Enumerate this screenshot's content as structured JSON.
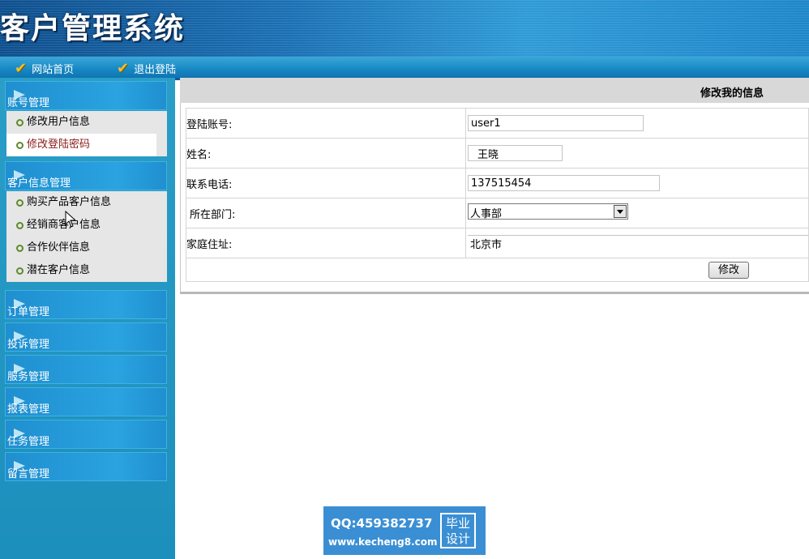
{
  "header": {
    "title": "客户管理系统"
  },
  "topnav": [
    {
      "label": "网站首页"
    },
    {
      "label": "退出登陆"
    }
  ],
  "sidebar": {
    "groups": [
      {
        "label": "账号管理",
        "items": [
          "修改用户信息",
          "修改登陆密码"
        ],
        "active_item": "修改登陆密码"
      },
      {
        "label": "客户信息管理",
        "items": [
          "购买产品客户信息",
          "经销商客户信息",
          "合作伙伴信息",
          "潜在客户信息"
        ]
      },
      {
        "label": "订单管理",
        "items": []
      },
      {
        "label": "投诉管理",
        "items": []
      },
      {
        "label": "服务管理",
        "items": []
      },
      {
        "label": "报表管理",
        "items": []
      },
      {
        "label": "任务管理",
        "items": []
      },
      {
        "label": "留言管理",
        "items": []
      }
    ]
  },
  "main": {
    "title": "修改我的信息",
    "form": {
      "account_label": "登陆账号:",
      "account_value": "user1",
      "name_label": "姓名:",
      "name_value": "王晓",
      "phone_label": "联系电话:",
      "phone_value": "137515454",
      "dept_label": "所在部门:",
      "dept_value": "人事部",
      "address_label": "家庭住址:",
      "address_value": "北京市",
      "submit_label": "修改"
    }
  },
  "watermark": {
    "qq": "QQ:459382737",
    "site": "www.kecheng8.com",
    "stamp_line1": "毕业",
    "stamp_line2": "设计"
  },
  "colors": {
    "header_blue": "#1a6fb3",
    "sidebar_blue": "#2a9ec7",
    "active_item_text": "#8b1a1a",
    "bullet_green": "#5d8a2a"
  }
}
